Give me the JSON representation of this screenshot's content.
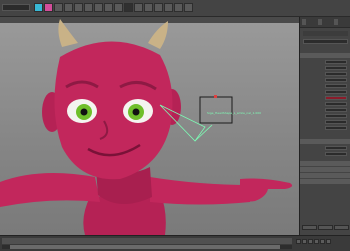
{
  "top_bar": {
    "menu_selector": "",
    "shelf_buttons": [
      "cyan",
      "magenta",
      "grey",
      "grey",
      "grey",
      "grey",
      "grey",
      "grey",
      "grey",
      "dark",
      "grey",
      "grey",
      "grey",
      "grey",
      "grey",
      "grey"
    ]
  },
  "viewport": {
    "locator_label": "Sige_HeadShape_L_smile_nal_1.000"
  },
  "panel": {
    "tabs": [
      "",
      "",
      ""
    ]
  },
  "colors": {
    "character_skin": "#c2275c",
    "skin_shadow": "#8e1a44",
    "horn": "#c9b287",
    "iris": "#6fbf2a",
    "locator_line": "#7dfcb5",
    "locator_box": "#1a1a1a",
    "background_grey": "#8f8f8f"
  }
}
